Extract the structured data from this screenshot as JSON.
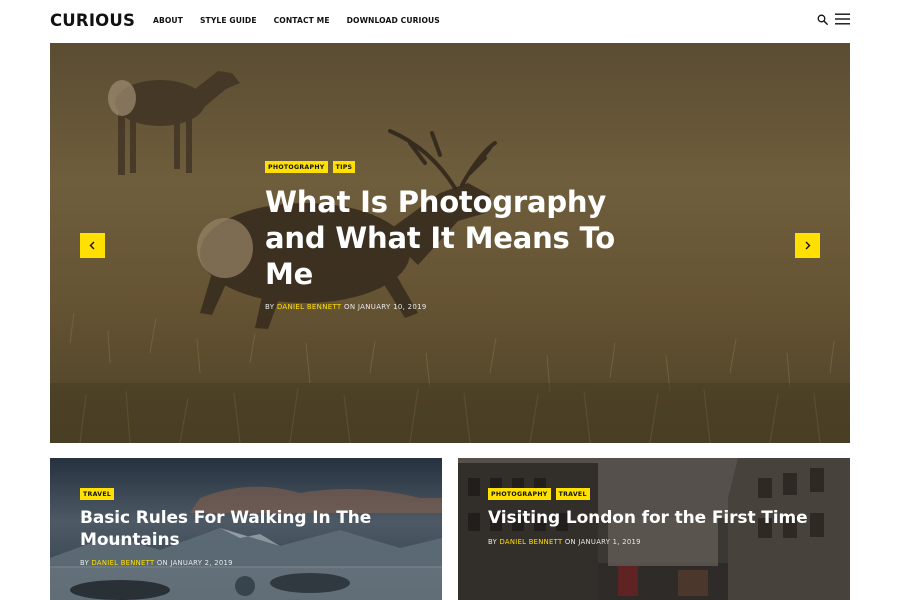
{
  "header": {
    "logo": "CURIOUS",
    "nav": [
      "ABOUT",
      "STYLE GUIDE",
      "CONTACT ME",
      "DOWNLOAD CURIOUS"
    ],
    "search_icon": "search-icon",
    "menu_icon": "hamburger-menu-icon"
  },
  "hero": {
    "tags": [
      "PHOTOGRAPHY",
      "TIPS"
    ],
    "title": "What Is Photography and What It Means To Me",
    "meta_by": "BY",
    "author": "DANIEL BENNETT",
    "meta_on": "ON",
    "date": "JANUARY 10, 2019",
    "prev_icon": "chevron-left-icon",
    "next_icon": "chevron-right-icon"
  },
  "cards": [
    {
      "tags": [
        "TRAVEL"
      ],
      "title": "Basic Rules For Walking In The Mountains",
      "meta_by": "BY",
      "author": "DANIEL BENNETT",
      "meta_on": "ON",
      "date": "JANUARY 2, 2019"
    },
    {
      "tags": [
        "PHOTOGRAPHY",
        "TRAVEL"
      ],
      "title": "Visiting London for the First Time",
      "meta_by": "BY",
      "author": "DANIEL BENNETT",
      "meta_on": "ON",
      "date": "JANUARY 1, 2019"
    }
  ],
  "colors": {
    "accent": "#ffe000",
    "text": "#111111",
    "white": "#ffffff"
  }
}
